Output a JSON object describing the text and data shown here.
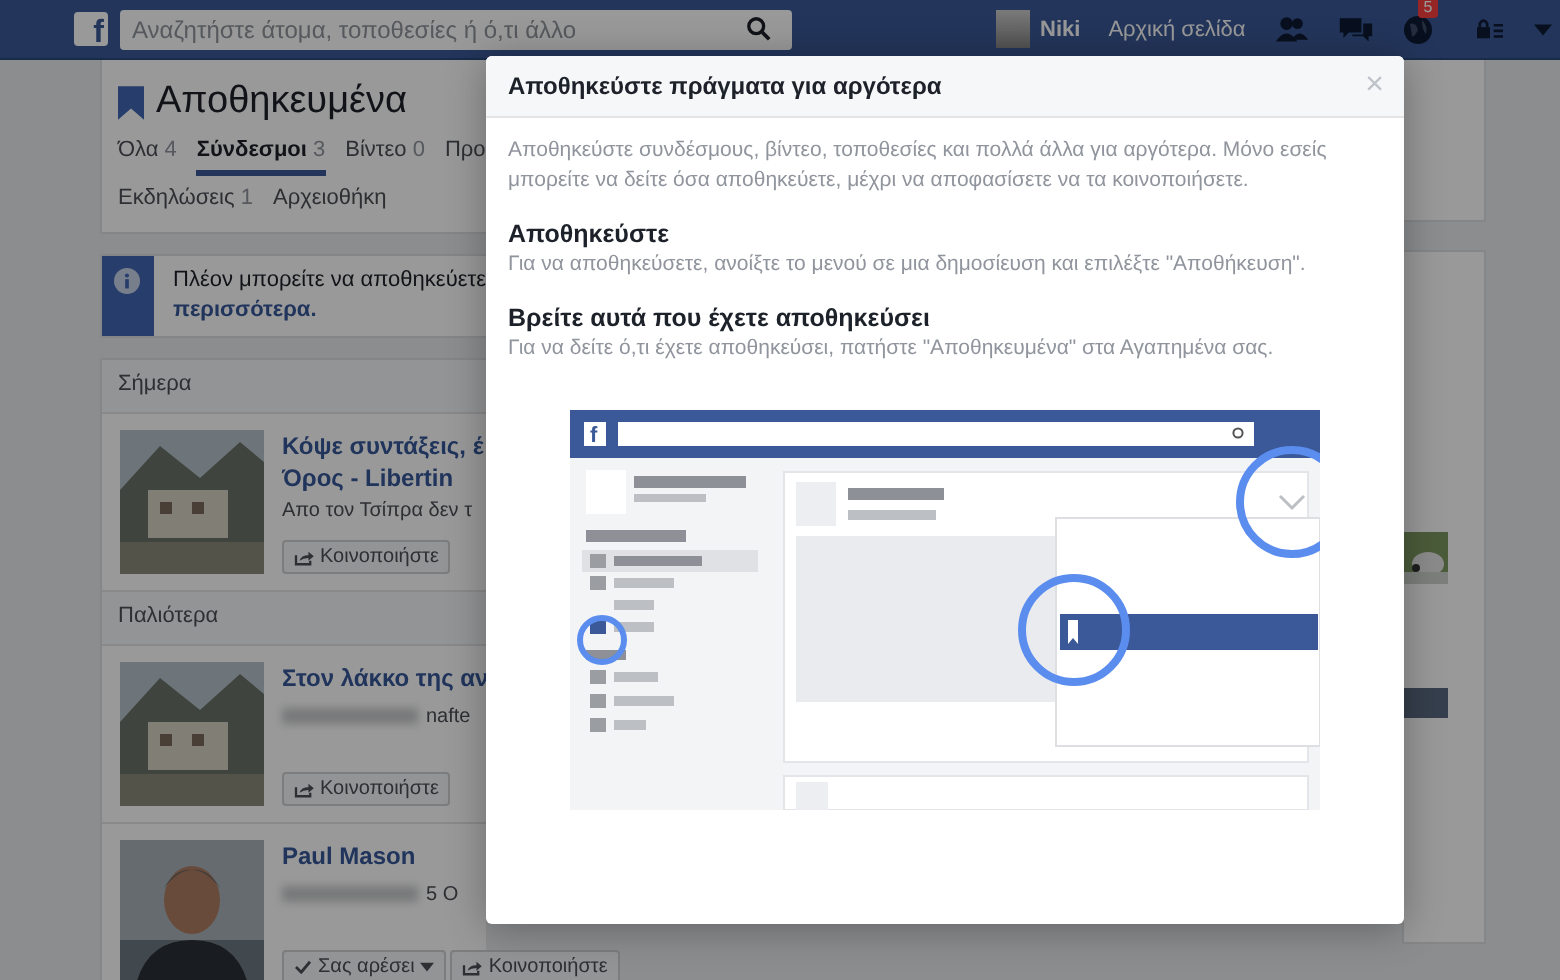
{
  "top_bar": {
    "logo": "f",
    "search": {
      "placeholder": "Αναζητήστε άτομα, τοποθεσίες ή ό,τι άλλο"
    },
    "user": "Niki",
    "home": "Αρχική σελίδα",
    "notifications_badge": "5"
  },
  "page": {
    "title": "Αποθηκευμένα",
    "tabs": [
      {
        "label": "Όλα",
        "count": "4",
        "selected": false
      },
      {
        "label": "Σύνδεσμοι",
        "count": "3",
        "selected": true
      },
      {
        "label": "Βίντεο",
        "count": "0",
        "selected": false
      },
      {
        "label": "Προ",
        "selected": false
      },
      {
        "label": "Εκδηλώσεις",
        "count": "1",
        "selected": false
      },
      {
        "label": "Αρχειοθήκη",
        "selected": false
      }
    ],
    "info_banner": {
      "text": "Πλέον μπορείτε να αποθηκεύετε",
      "link": "περισσότερα."
    },
    "sections": [
      {
        "heading": "Σήμερα",
        "items": [
          {
            "title_lines": [
              "Κόψε συντάξεις, έ",
              "Όρος - Libertin"
            ],
            "description": "Απο τον Τσίπρα δεν τ",
            "buttons": [
              {
                "kind": "share",
                "label": "Κοινοποιήστε"
              }
            ]
          }
        ]
      },
      {
        "heading": "Παλιότερα",
        "items": [
          {
            "title_lines": [
              "Στον λάκκο της αν"
            ],
            "source": "nafte",
            "buttons": [
              {
                "kind": "share",
                "label": "Κοινοποιήστε"
              }
            ]
          },
          {
            "kind": "person",
            "title_lines": [
              "Paul Mason"
            ],
            "source": "5 Ο",
            "buttons": [
              {
                "kind": "like",
                "label": "Σας αρέσει"
              },
              {
                "kind": "share",
                "label": "Κοινοποιήστε"
              }
            ]
          }
        ]
      }
    ]
  },
  "modal": {
    "title": "Αποθηκεύστε πράγματα για αργότερα",
    "close": "×",
    "intro": "Αποθηκεύστε συνδέσμους, βίντεο, τοποθεσίες και πολλά άλλα για αργότερα. Μόνο εσείς μπορείτε να δείτε όσα αποθηκεύετε, μέχρι να αποφασίσετε να τα κοινοποιήσετε.",
    "sections": [
      {
        "heading": "Αποθηκεύστε",
        "text": "Για να αποθηκεύσετε, ανοίξτε το μενού σε μια δημοσίευση και επιλέξτε \"Αποθήκευση\"."
      },
      {
        "heading": "Βρείτε αυτά που έχετε αποθηκεύσει",
        "text": "Για να δείτε ό,τι έχετε αποθηκεύσει, πατήστε \"Αποθηκευμένα\" στα Αγαπημένα σας."
      }
    ],
    "illustration": {
      "logo": "f"
    }
  }
}
